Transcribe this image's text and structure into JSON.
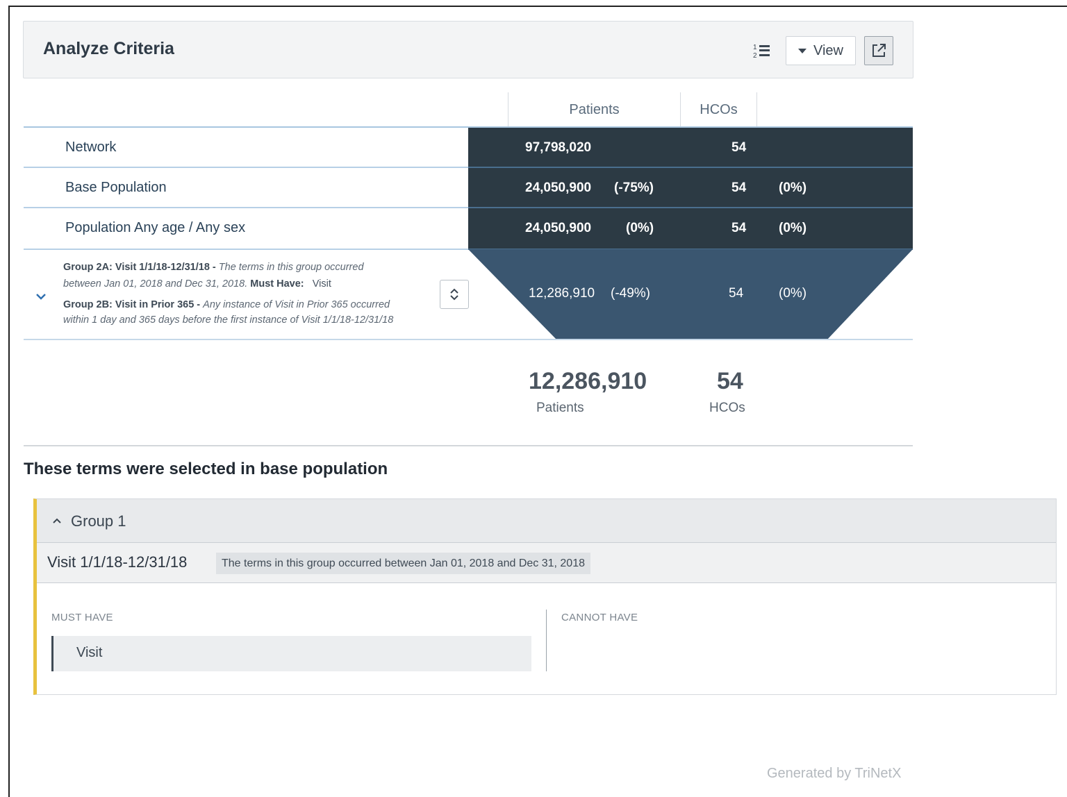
{
  "header": {
    "title": "Analyze Criteria",
    "view_label": "View",
    "sort_icon": "numbered-list-icon",
    "export_icon": "external-link-icon"
  },
  "table": {
    "columns": [
      "Patients",
      "HCOs"
    ],
    "rows": [
      {
        "label": "Network",
        "patients": "97,798,020",
        "patients_pct": "",
        "hcos": "54",
        "hcos_pct": ""
      },
      {
        "label": "Base Population",
        "patients": "24,050,900",
        "patients_pct": "(-75%)",
        "hcos": "54",
        "hcos_pct": "(0%)"
      },
      {
        "label": "Population Any age / Any sex",
        "patients": "24,050,900",
        "patients_pct": "(0%)",
        "hcos": "54",
        "hcos_pct": "(0%)"
      }
    ],
    "group_row": {
      "a_title": "Group 2A: Visit 1/1/18-12/31/18 -",
      "a_desc1": "The terms in this group occurred",
      "a_desc2": "between Jan 01, 2018 and Dec 31, 2018.",
      "a_must_label": "Must Have:",
      "a_must_value": "Visit",
      "b_title": "Group 2B: Visit in Prior 365 -",
      "b_desc1": "Any instance of Visit in Prior 365 occurred",
      "b_desc2": "within 1 day and 365 days before the first instance of Visit 1/1/18-12/31/18",
      "patients": "12,286,910",
      "patients_pct": "(-49%)",
      "hcos": "54",
      "hcos_pct": "(0%)"
    }
  },
  "totals": {
    "patients": "12,286,910",
    "patients_label": "Patients",
    "hcos": "54",
    "hcos_label": "HCOs"
  },
  "base_section": {
    "title": "These terms were selected in base population",
    "group_title": "Group 1",
    "visit_name": "Visit 1/1/18-12/31/18",
    "visit_desc": "The terms in this group occurred between Jan 01, 2018 and Dec 31, 2018",
    "must_have_label": "MUST HAVE",
    "cannot_have_label": "CANNOT HAVE",
    "must_have_items": [
      "Visit"
    ]
  },
  "footer": "Generated by TriNetX",
  "colors": {
    "dark_block": "#2c3a44",
    "funnel": "#3a5670",
    "accent_yellow": "#e8c23e"
  }
}
